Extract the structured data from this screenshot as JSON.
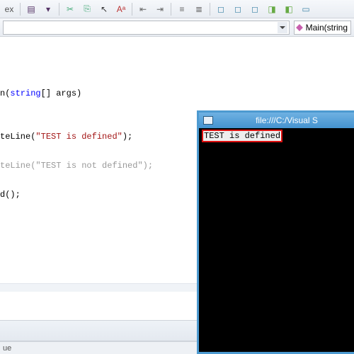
{
  "toolbar": {
    "combo2_text": "Main(string"
  },
  "code": {
    "line1_pre": "n(",
    "line1_type": "string",
    "line1_post": "[] args)",
    "line3_call": "teLine(",
    "line3_str": "\"TEST is defined\"",
    "line3_end": ");",
    "line4_call": "teLine(",
    "line4_str": "\"TEST is not defined\"",
    "line4_end": ");",
    "line5": "d();"
  },
  "console": {
    "title": "file:///C:/Visual S",
    "output": "TEST is defined"
  },
  "bottom": {
    "tab": "ue"
  }
}
